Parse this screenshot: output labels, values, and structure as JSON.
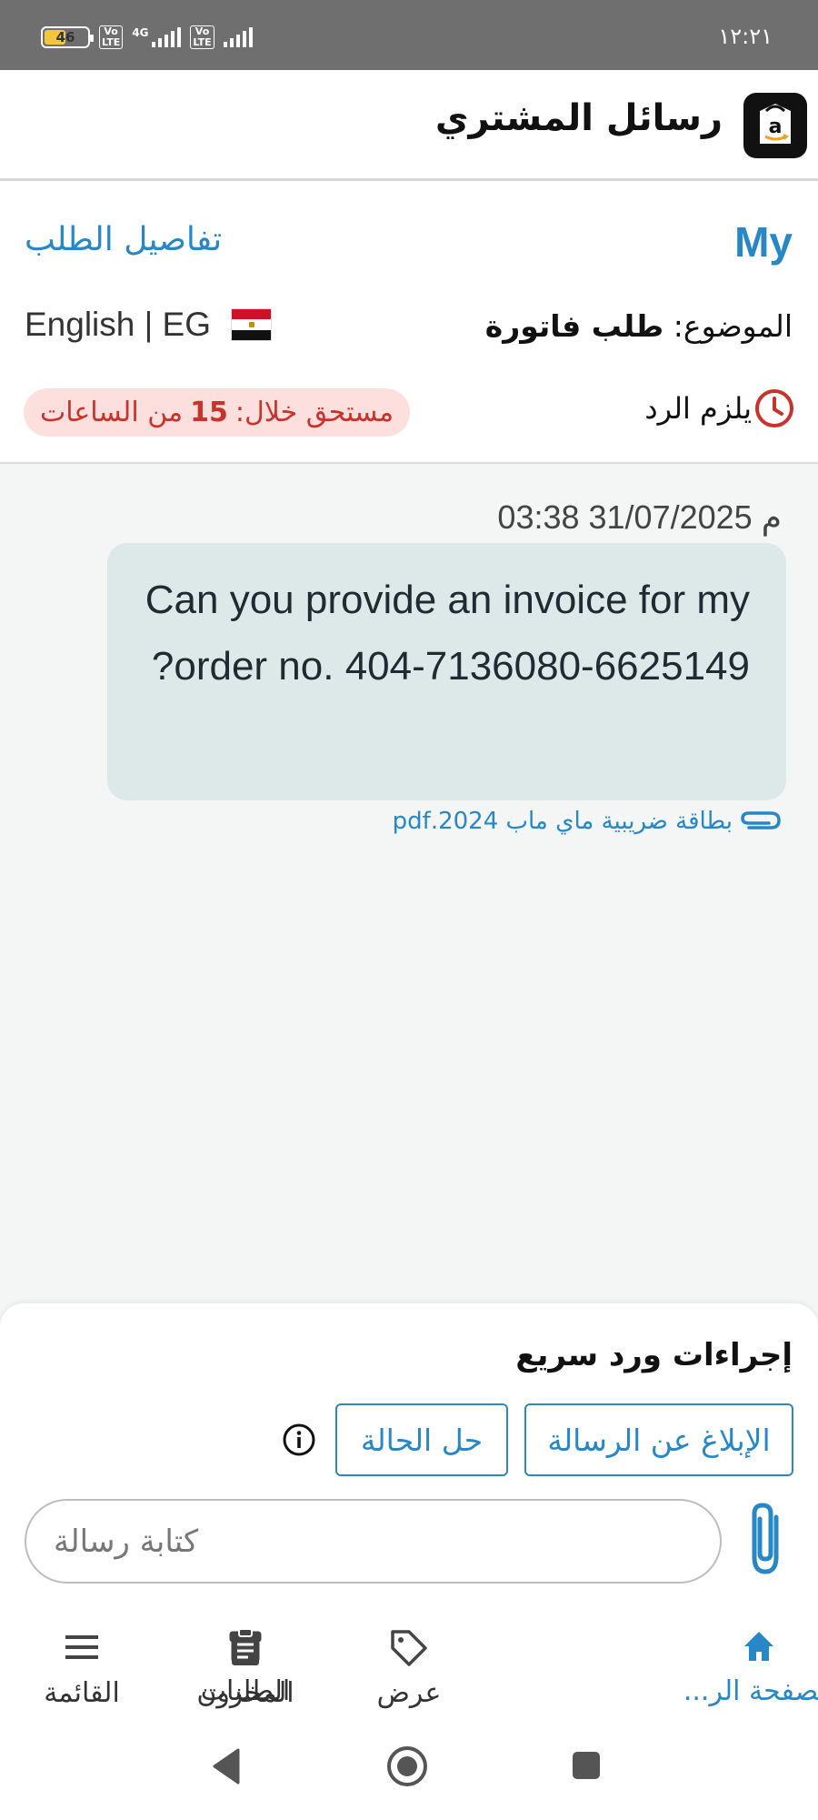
{
  "status_bar": {
    "battery": "46",
    "network": "4G",
    "volte_label": "Vo LTE",
    "time": "١٢:٢١"
  },
  "header": {
    "title": "رسائل المشتري"
  },
  "conversation": {
    "buyer_name": "My",
    "order_details_link": "تفاصيل الطلب",
    "subject_label": "الموضوع:",
    "subject_value": "طلب فاتورة",
    "language": "English | EG",
    "reply_required": "يلزم الرد",
    "due_prefix": "مستحق خلال:",
    "due_hours": "15",
    "due_suffix": "من الساعات"
  },
  "message": {
    "timestamp": "03:38 31/07/2025 م",
    "text": "Can you provide an invoice for my order no. 404-7136080-6625149?",
    "attachment": "بطاقة ضريبية ماي ماب 2024.pdf"
  },
  "quick_actions": {
    "title": "إجراءات ورد سريع",
    "report_label": "الإبلاغ عن الرسالة",
    "resolve_label": "حل الحالة",
    "compose_placeholder": "كتابة رسالة"
  },
  "bottom_nav": {
    "home": "الصفحة الر...",
    "orders": "الطلبات",
    "offers": "عرض",
    "inventory": "المخزون",
    "menu": "القائمة"
  },
  "colors": {
    "accent": "#2787c7",
    "due_bg": "#fde0de",
    "due_text": "#c9332b",
    "bubble": "#dde8e9"
  }
}
